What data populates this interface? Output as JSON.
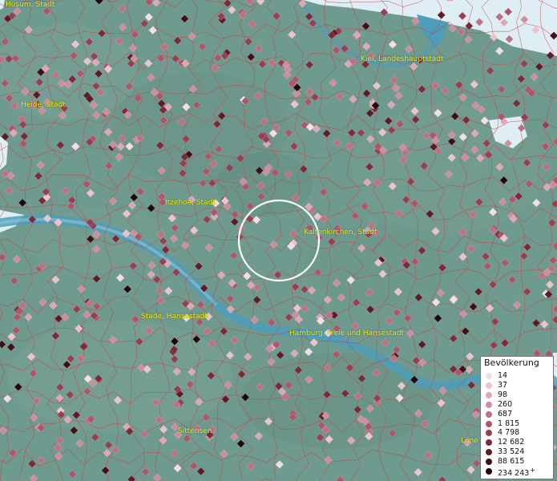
{
  "map": {
    "colors": {
      "land": "#6f9a8f",
      "water": "#4d9dbb",
      "sea": "#dfeef5",
      "borders": "#d23c3c",
      "highlight_circle": "#ffffff",
      "label": "#e8ec00"
    },
    "cities": [
      {
        "name": "Husum, Stadt"
      },
      {
        "name": "Kiel, Landeshauptstadt"
      },
      {
        "name": "Heide, Stadt"
      },
      {
        "name": "Itzehoe, Stadt"
      },
      {
        "name": "Kaltenkirchen, Stadt"
      },
      {
        "name": "Stade, Hansestadt"
      },
      {
        "name": "Hamburg, Freie und Hansestadt"
      },
      {
        "name": "Sittensen"
      },
      {
        "name": "Lüne"
      }
    ]
  },
  "legend": {
    "title": "Bevölkerung",
    "items": [
      {
        "label": "14",
        "color": "#f5dde6"
      },
      {
        "label": "37",
        "color": "#ecc2cf"
      },
      {
        "label": "98",
        "color": "#dea7b6"
      },
      {
        "label": "260",
        "color": "#cf8d9d"
      },
      {
        "label": "687",
        "color": "#bf7184"
      },
      {
        "label": "1 815",
        "color": "#ad5669"
      },
      {
        "label": "4 798",
        "color": "#963f50"
      },
      {
        "label": "12 682",
        "color": "#7c2a39"
      },
      {
        "label": "33 524",
        "color": "#5f1a25"
      },
      {
        "label": "88 615",
        "color": "#420f16"
      },
      {
        "label": "234 243",
        "color": "#22060a"
      }
    ],
    "overflow_marker": "+"
  }
}
